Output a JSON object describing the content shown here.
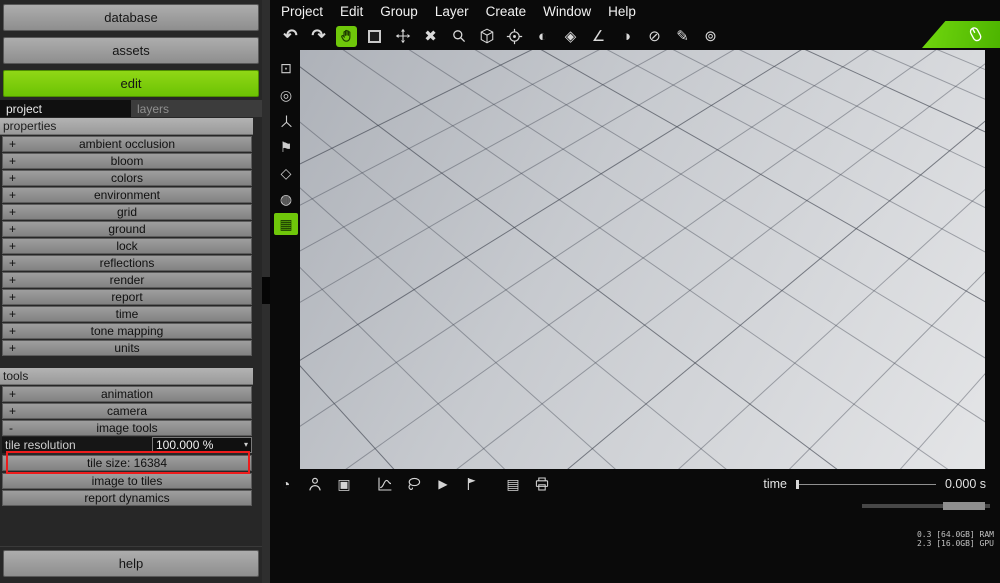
{
  "colors": {
    "accent_green": "#6fc70a",
    "annotation_red": "#ed1c1c"
  },
  "sidebar": {
    "database_button": "database",
    "assets_button": "assets",
    "edit_button": "edit",
    "tabs": {
      "project": "project",
      "layers": "layers"
    },
    "properties_header": "properties",
    "properties": [
      {
        "prefix": "+",
        "label": "ambient occlusion"
      },
      {
        "prefix": "+",
        "label": "bloom"
      },
      {
        "prefix": "+",
        "label": "colors"
      },
      {
        "prefix": "+",
        "label": "environment"
      },
      {
        "prefix": "+",
        "label": "grid"
      },
      {
        "prefix": "+",
        "label": "ground"
      },
      {
        "prefix": "+",
        "label": "lock"
      },
      {
        "prefix": "+",
        "label": "reflections"
      },
      {
        "prefix": "+",
        "label": "render"
      },
      {
        "prefix": "+",
        "label": "report"
      },
      {
        "prefix": "+",
        "label": "time"
      },
      {
        "prefix": "+",
        "label": "tone mapping"
      },
      {
        "prefix": "+",
        "label": "units"
      }
    ],
    "tools_header": "tools",
    "tools": [
      {
        "prefix": "+",
        "label": "animation"
      },
      {
        "prefix": "+",
        "label": "camera"
      },
      {
        "prefix": "-",
        "label": "image tools"
      }
    ],
    "tile_resolution": {
      "label": "tile resolution",
      "value": "100.000 %"
    },
    "tile_size_button": "tile size: 16384",
    "image_to_tiles_button": "image to tiles",
    "report_dynamics_button": "report dynamics",
    "help_button": "help"
  },
  "menubar": {
    "items": [
      {
        "label": "Project"
      },
      {
        "label": "Edit"
      },
      {
        "label": "Group"
      },
      {
        "label": "Layer"
      },
      {
        "label": "Create"
      },
      {
        "label": "Window"
      },
      {
        "label": "Help"
      }
    ]
  },
  "icons": {
    "undo": "↶",
    "redo": "↷",
    "delete": "✖",
    "sphere": "◐",
    "diamond": "◈",
    "angle": "∠",
    "half_circle": "◑",
    "slash_circle": "⊘",
    "pen": "✎",
    "ring": "⊚",
    "display": "⊡",
    "record": "◎",
    "flag": "⚑",
    "tag": "◇",
    "film": "◍",
    "grid": "▦",
    "orbit": "◔",
    "screen": "▣",
    "play": "▶",
    "doc": "▤",
    "spinner": "▾"
  },
  "timeline": {
    "label": "time",
    "value": "0.000 s"
  },
  "status": {
    "ram": "0.3 [64.0GB] RAM",
    "gpu": "2.3 [16.0GB] GPU"
  }
}
